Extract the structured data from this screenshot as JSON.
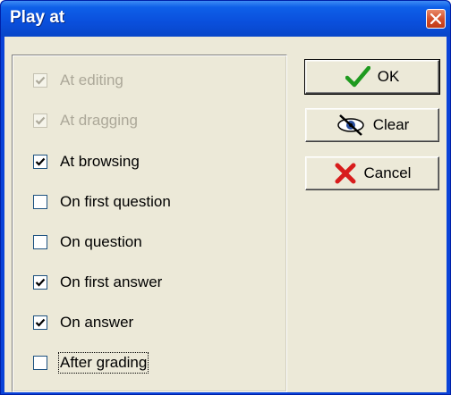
{
  "window": {
    "title": "Play at"
  },
  "options": [
    {
      "label": "At editing",
      "checked": true,
      "disabled": true
    },
    {
      "label": "At dragging",
      "checked": true,
      "disabled": true
    },
    {
      "label": "At browsing",
      "checked": true,
      "disabled": false
    },
    {
      "label": "On first question",
      "checked": false,
      "disabled": false
    },
    {
      "label": "On question",
      "checked": false,
      "disabled": false
    },
    {
      "label": "On first answer",
      "checked": true,
      "disabled": false
    },
    {
      "label": "On answer",
      "checked": true,
      "disabled": false
    },
    {
      "label": "After grading",
      "checked": false,
      "disabled": false,
      "focused": true
    }
  ],
  "buttons": {
    "ok": {
      "label": "OK",
      "icon": "checkmark-icon"
    },
    "clear": {
      "label": "Clear",
      "icon": "eye-crossed-icon"
    },
    "cancel": {
      "label": "Cancel",
      "icon": "red-x-icon"
    }
  },
  "colors": {
    "titlebar": "#0a4fdc",
    "face": "#ece9d8",
    "ok_check": "#1f9a1f",
    "cancel_x": "#d81c1c"
  }
}
